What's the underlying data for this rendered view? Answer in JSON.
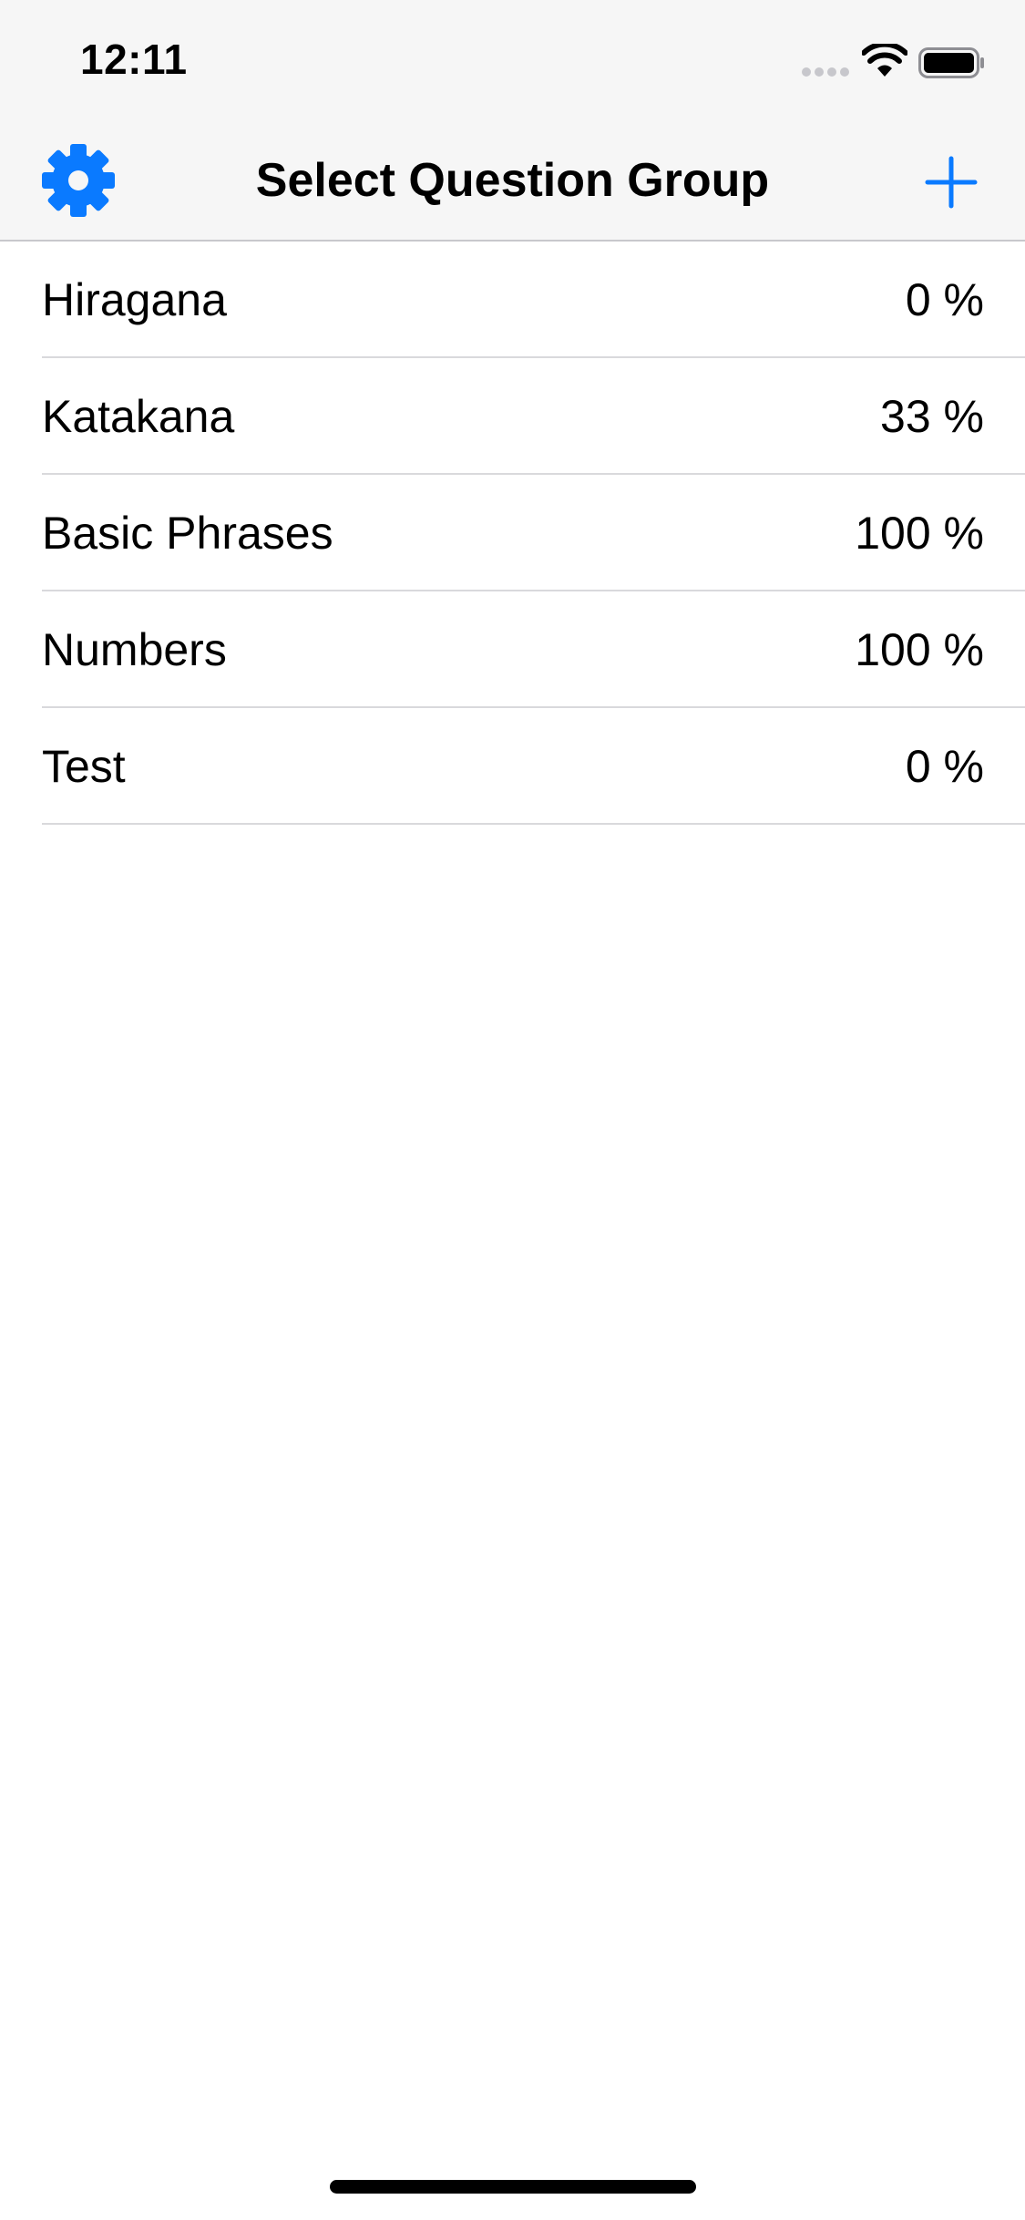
{
  "status_bar": {
    "time": "12:11",
    "icons": [
      "signal-icon",
      "wifi-icon",
      "battery-icon"
    ]
  },
  "nav_bar": {
    "title": "Select Question Group",
    "left_icon": "gear-icon",
    "right_icon": "plus-icon",
    "accent_color": "#0a7aff"
  },
  "groups": [
    {
      "name": "Hiragana",
      "progress": "0 %"
    },
    {
      "name": "Katakana",
      "progress": "33 %"
    },
    {
      "name": "Basic Phrases",
      "progress": "100 %"
    },
    {
      "name": "Numbers",
      "progress": "100 %"
    },
    {
      "name": "Test",
      "progress": "0 %"
    }
  ]
}
